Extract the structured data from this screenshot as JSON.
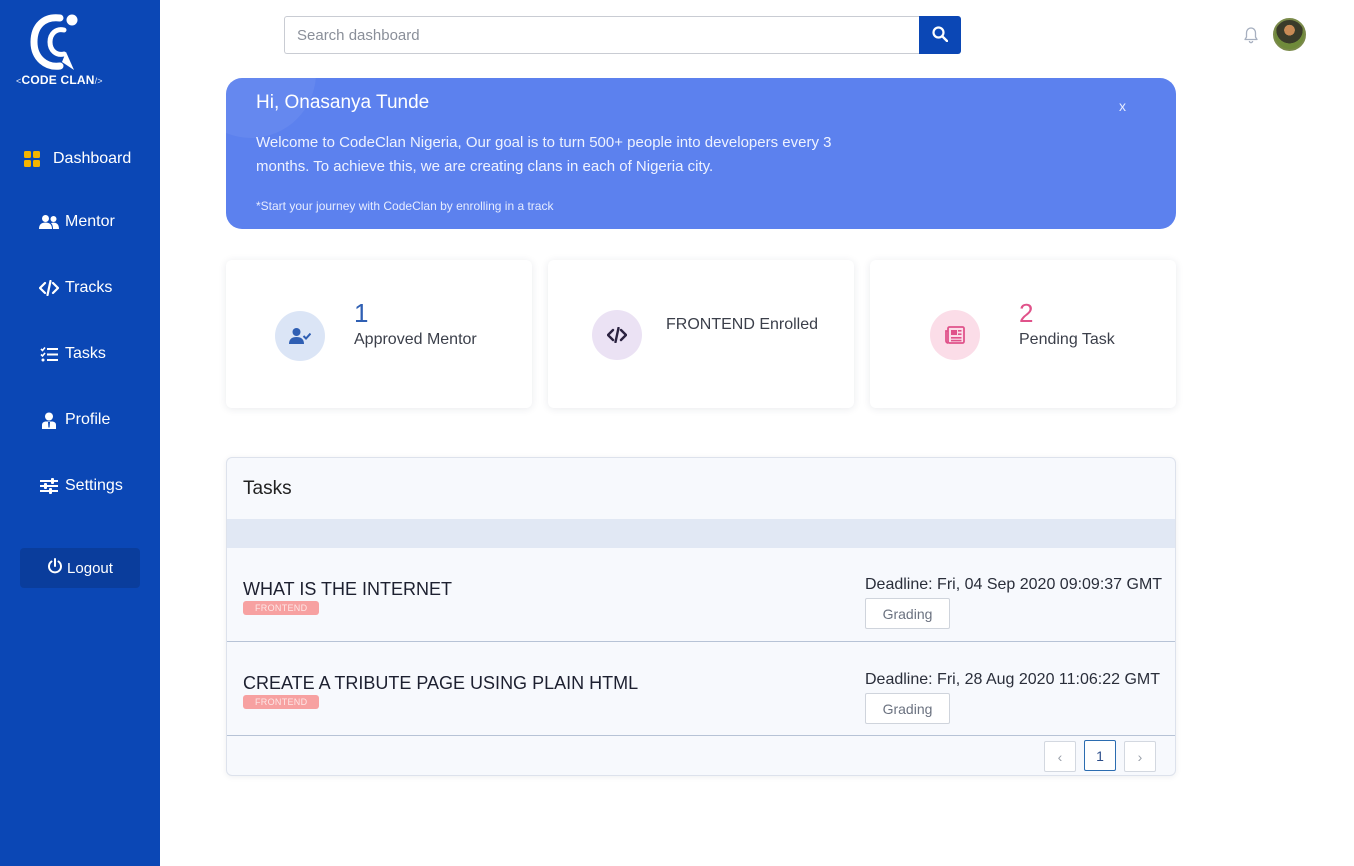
{
  "brand": {
    "logo_text": "CODE CLAN",
    "bracket_left": "<",
    "bracket_right": "/>"
  },
  "sidebar": {
    "items": [
      {
        "label": "Dashboard",
        "icon": "grid-icon",
        "active": true
      },
      {
        "label": "Mentor",
        "icon": "users-icon"
      },
      {
        "label": "Tracks",
        "icon": "code-icon"
      },
      {
        "label": "Tasks",
        "icon": "tasks-icon"
      },
      {
        "label": "Profile",
        "icon": "user-tie-icon"
      },
      {
        "label": "Settings",
        "icon": "sliders-icon"
      }
    ],
    "logout_label": "Logout"
  },
  "header": {
    "search_placeholder": "Search dashboard",
    "search_icon": "search-icon",
    "notification_icon": "bell-icon"
  },
  "banner": {
    "title": "Hi, Onasanya Tunde",
    "message": "Welcome to CodeClan Nigeria, Our goal is to turn 500+ people into developers every 3 months. To achieve this, we are creating clans in each of Nigeria city.",
    "note": "*Start your journey with CodeClan by enrolling in a track",
    "close_label": "x"
  },
  "stats": [
    {
      "value": "1",
      "label": "Approved Mentor",
      "icon": "user-check-icon",
      "color": "#2f5fb3"
    },
    {
      "value": "",
      "label": "FRONTEND Enrolled",
      "icon": "code-icon",
      "color": "#4a3a6a"
    },
    {
      "value": "2",
      "label": "Pending Task",
      "icon": "newspaper-icon",
      "color": "#e0528a"
    }
  ],
  "tasks": {
    "title": "Tasks",
    "rows": [
      {
        "name": "WHAT IS THE INTERNET",
        "tag": "FRONTEND",
        "deadline": "Deadline: Fri, 04 Sep 2020 09:09:37 GMT",
        "status": "Grading"
      },
      {
        "name": "CREATE A TRIBUTE PAGE USING PLAIN HTML",
        "tag": "FRONTEND",
        "deadline": "Deadline: Fri, 28 Aug 2020 11:06:22 GMT",
        "status": "Grading"
      }
    ],
    "pagination": {
      "prev": "‹",
      "current_page": "1",
      "next": "›"
    }
  },
  "colors": {
    "sidebar": "#0b47b5",
    "banner": "#5c81ee",
    "accent_active": "#f5b400",
    "tag": "#f7a1a1"
  }
}
